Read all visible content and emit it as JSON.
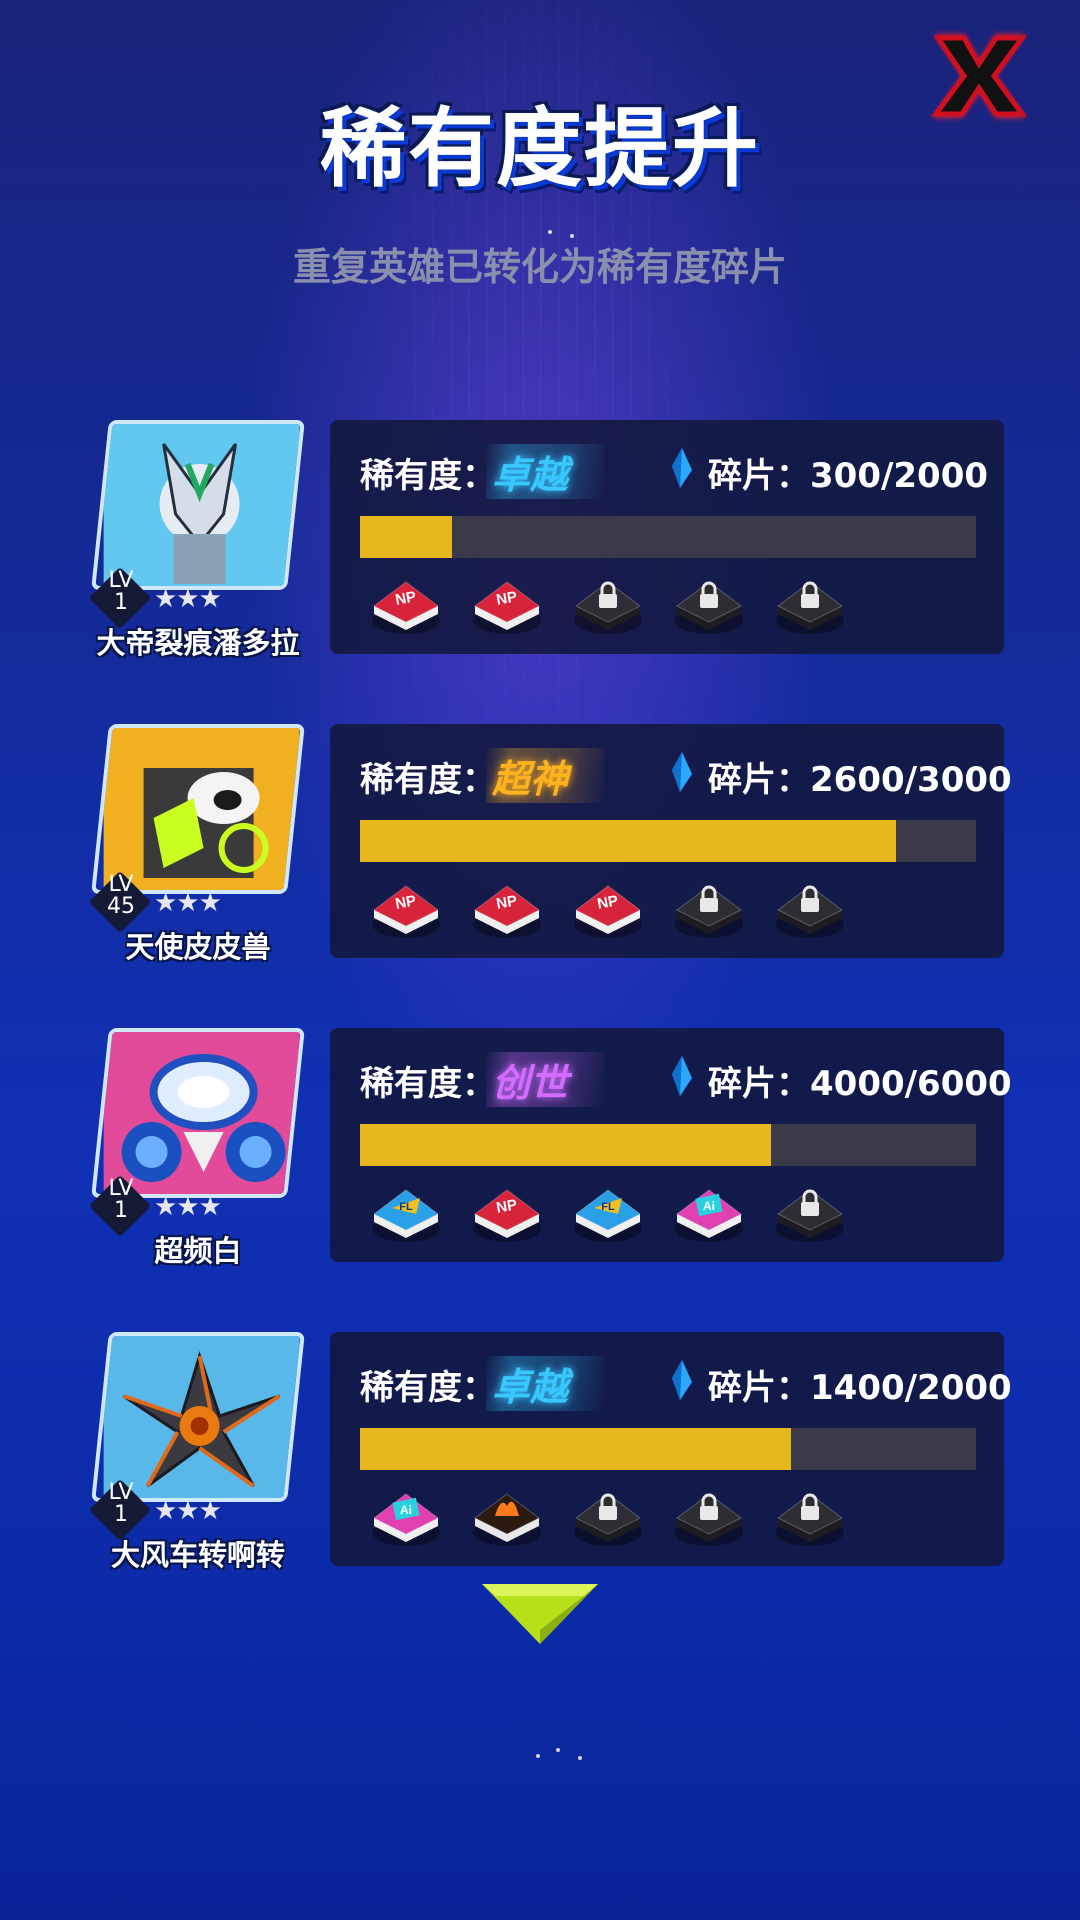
{
  "title": "稀有度提升",
  "subtitle": "重复英雄已转化为稀有度碎片",
  "close_icon": "close-x-icon",
  "rarity_label": "稀有度：",
  "fragment_label": "碎片：",
  "colors": {
    "progress_fill": "#e6b81d",
    "progress_track": "#3a3a48",
    "panel": "#12183c",
    "close_x": "#e0142a"
  },
  "heroes": [
    {
      "name": "大帝裂痕潘多拉",
      "level_label": "LV",
      "level": "1",
      "stars": "★★★",
      "rarity": "卓越",
      "rarity_color": "#38c8ff",
      "fragments": "300/2000",
      "progress": 0.15,
      "card_color": "#62c8f0",
      "slots": [
        "np-badge-icon",
        "np-badge-icon",
        "lock-icon",
        "lock-icon",
        "lock-icon"
      ]
    },
    {
      "name": "天使皮皮兽",
      "level_label": "LV",
      "level": "45",
      "stars": "★★★",
      "rarity": "超神",
      "rarity_color": "#ffb21f",
      "fragments": "2600/3000",
      "progress": 0.87,
      "card_color": "#f0b020",
      "slots": [
        "np-badge-icon",
        "np-badge-icon",
        "np-badge-icon",
        "lock-icon",
        "lock-icon"
      ]
    },
    {
      "name": "超频白",
      "level_label": "LV",
      "level": "1",
      "stars": "★★★",
      "rarity": "创世",
      "rarity_color": "#d46cff",
      "fragments": "4000/6000",
      "progress": 0.667,
      "card_color": "#e24a9a",
      "slots": [
        "blue-badge-icon",
        "np-badge-icon",
        "blue-badge-icon",
        "pink-badge-icon",
        "lock-icon"
      ]
    },
    {
      "name": "大风车转啊转",
      "level_label": "LV",
      "level": "1",
      "stars": "★★★",
      "rarity": "卓越",
      "rarity_color": "#38c8ff",
      "fragments": "1400/2000",
      "progress": 0.7,
      "card_color": "#58b8ea",
      "slots": [
        "pink-badge-icon",
        "fire-badge-icon",
        "lock-icon",
        "lock-icon",
        "lock-icon"
      ]
    }
  ],
  "scroll_icon": "arrow-down-icon"
}
